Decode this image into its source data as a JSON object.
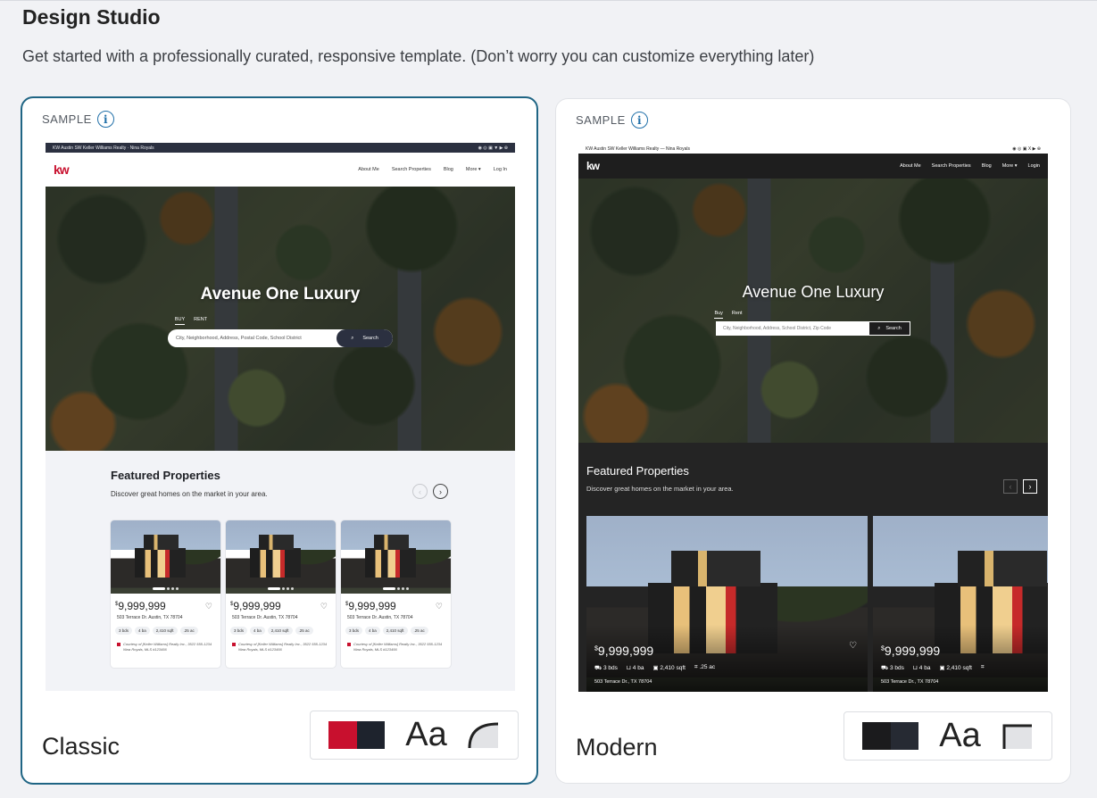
{
  "page": {
    "title": "Design Studio",
    "subtitle": "Get started with a professionally curated, responsive template. (Don’t worry you can customize everything later)"
  },
  "templates": [
    {
      "name": "Classic",
      "sample_label": "SAMPLE",
      "selected": true,
      "colors": [
        "#c8102e",
        "#1e232d"
      ],
      "font_sample": "Aa",
      "corner_style": "rounded",
      "preview": {
        "topbar": "KW Austin SW Keller Williams Realty · Nina Royals",
        "topbar_icons": "◉ ◎ ▣ ▼ ▶   ⊕",
        "logo": "kw",
        "nav": [
          "About Me",
          "Search Properties",
          "Blog",
          "More ▾",
          "Log In"
        ],
        "hero_title": "Avenue One Luxury",
        "hero_tabs": [
          "BUY",
          "RENT"
        ],
        "search_placeholder": "City, Neighborhood, Address, Postal Code, School District",
        "search_button": "Search",
        "featured_title": "Featured Properties",
        "featured_subtitle": "Discover great homes on the market in your area.",
        "listings": [
          {
            "price": "9,999,999",
            "address": "503 Terrace Dr. Austin, TX 78704",
            "stats": [
              "3 bds",
              "4 ba",
              "2,410 sqft",
              ".25 ac"
            ],
            "courtesy": "Courtesy of [Keller Williams] Realty Inc., 3522 555-1234 Nina Royals, MLS #123456"
          },
          {
            "price": "9,999,999",
            "address": "503 Terrace Dr. Austin, TX 78704",
            "stats": [
              "3 bds",
              "4 ba",
              "2,410 sqft",
              ".25 ac"
            ],
            "courtesy": "Courtesy of [Keller Williams] Realty Inc., 3522 555-1234 Nina Royals, MLS #123456"
          },
          {
            "price": "9,999,999",
            "address": "503 Terrace Dr. Austin, TX 78704",
            "stats": [
              "3 bds",
              "4 ba",
              "2,410 sqft",
              ".25 ac"
            ],
            "courtesy": "Courtesy of [Keller Williams] Realty Inc., 3522 555-1234 Nina Royals, MLS #123456"
          }
        ]
      }
    },
    {
      "name": "Modern",
      "sample_label": "SAMPLE",
      "selected": false,
      "colors": [
        "#1b1b1d",
        "#262a33"
      ],
      "font_sample": "Aa",
      "corner_style": "square",
      "preview": {
        "topbar": "KW Austin SW Keller Williams Realty  —  Nina Royals",
        "topbar_icons": "◉ ◎ ▣ X ▶   ⊕",
        "logo": "kw",
        "nav": [
          "About Me",
          "Search Properties",
          "Blog",
          "More ▾",
          "Login"
        ],
        "hero_title": "Avenue One Luxury",
        "hero_tabs": [
          "Buy",
          "Rent"
        ],
        "search_placeholder": "City, Neighborhood, Address, School District, Zip Code",
        "search_button": "Search",
        "featured_title": "Featured Properties",
        "featured_subtitle": "Discover great homes on the market in your area.",
        "listings": [
          {
            "price": "9,999,999",
            "address": "503 Terrace Dr., TX 78704",
            "stats": [
              "3 bds",
              "4 ba",
              "2,410 sqft",
              ".25 ac"
            ]
          },
          {
            "price": "9,999,999",
            "address": "503 Terrace Dr., TX 78704",
            "stats": [
              "3 bds",
              "4 ba",
              "2,410 sqft",
              ""
            ]
          }
        ]
      }
    }
  ]
}
